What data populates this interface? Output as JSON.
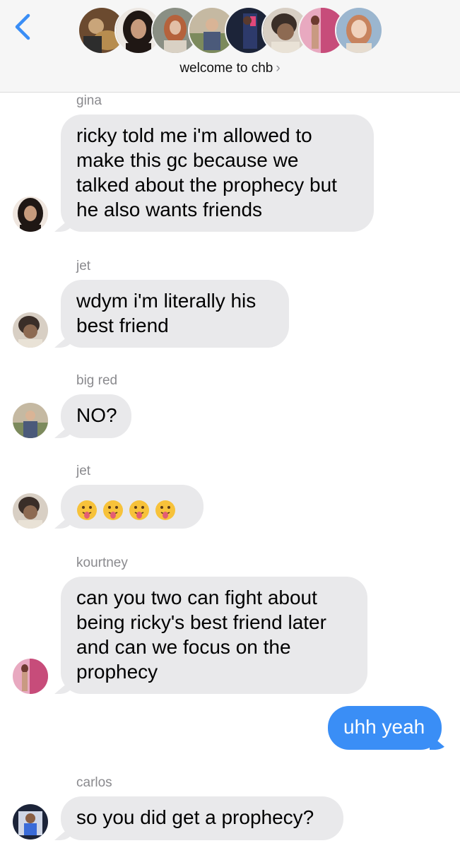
{
  "header": {
    "title": "welcome to chb",
    "chevron": "›",
    "back_icon": "chevron-left-icon",
    "accent_color": "#3a8ef6",
    "avatars": [
      {
        "name": "group-avatar-1",
        "colors": [
          "#6b4a2f",
          "#c9a57a",
          "#2d2d2d"
        ]
      },
      {
        "name": "group-avatar-2",
        "colors": [
          "#1f1714",
          "#c79b7d",
          "#3a2a22"
        ]
      },
      {
        "name": "group-avatar-3",
        "colors": [
          "#8a8f84",
          "#b5623c",
          "#d9d1c4"
        ]
      },
      {
        "name": "group-avatar-4",
        "colors": [
          "#7c8a5d",
          "#4b5a7a",
          "#c5b9a2"
        ]
      },
      {
        "name": "group-avatar-5",
        "colors": [
          "#1c2439",
          "#e0487a",
          "#2d3a6b"
        ]
      },
      {
        "name": "group-avatar-6",
        "colors": [
          "#3a2e28",
          "#8d6a52",
          "#d8cfc4"
        ]
      },
      {
        "name": "group-avatar-7",
        "colors": [
          "#c74c7a",
          "#e8a9c0",
          "#6d3b30"
        ]
      },
      {
        "name": "group-avatar-8",
        "colors": [
          "#9bb6cf",
          "#c7835e",
          "#e6dccf"
        ]
      }
    ]
  },
  "messages": [
    {
      "sender": "gina",
      "avatar_colors": [
        "#1f1714",
        "#c79b7d",
        "#efe6df"
      ],
      "lines": [
        "ricky told me i'm allowed to",
        "make this gc because we",
        "talked about the prophecy but",
        "he also wants friends"
      ]
    },
    {
      "sender": "jet",
      "avatar_colors": [
        "#3a2e28",
        "#8d6a52",
        "#d8cfc4"
      ],
      "lines": [
        "wdym i'm literally his",
        "best friend"
      ]
    },
    {
      "sender": "big red",
      "avatar_colors": [
        "#7c8a5d",
        "#4b5a7a",
        "#c5b9a2"
      ],
      "lines": [
        "NO?"
      ]
    },
    {
      "sender": "jet",
      "avatar_colors": [
        "#3a2e28",
        "#8d6a52",
        "#d8cfc4"
      ],
      "emojis": [
        "😛",
        "😛",
        "😛",
        "😛"
      ]
    },
    {
      "sender": "kourtney",
      "avatar_colors": [
        "#c74c7a",
        "#e8a9c0",
        "#6d3b30"
      ],
      "lines": [
        "can you two can fight about",
        "being ricky's best friend later",
        "and can we focus on the",
        "prophecy"
      ]
    },
    {
      "outgoing": true,
      "lines": [
        "uhh yeah"
      ]
    },
    {
      "sender": "carlos",
      "avatar_colors": [
        "#1c2439",
        "#3a6bd8",
        "#cfd6e6"
      ],
      "lines": [
        "so you did get a prophecy?"
      ]
    }
  ]
}
